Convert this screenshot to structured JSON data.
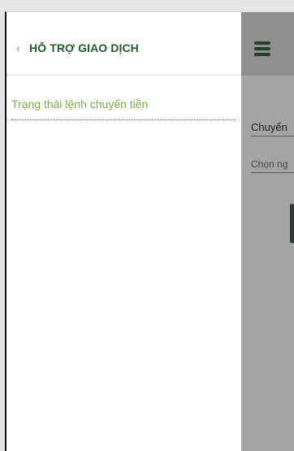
{
  "drawer": {
    "back_icon": "chevron-left-icon",
    "title": "HỖ TRỢ GIAO DỊCH",
    "items": [
      {
        "label": "Trạng thái lệnh chuyển tiền"
      }
    ]
  },
  "app": {
    "menu_icon": "hamburger-icon",
    "field_transfer_label": "Chuyển",
    "field_choose_placeholder": "Chọn ng"
  },
  "colors": {
    "title_green": "#215f2a",
    "item_green": "#7cb342",
    "overlay_gray": "#a4a4a4"
  }
}
